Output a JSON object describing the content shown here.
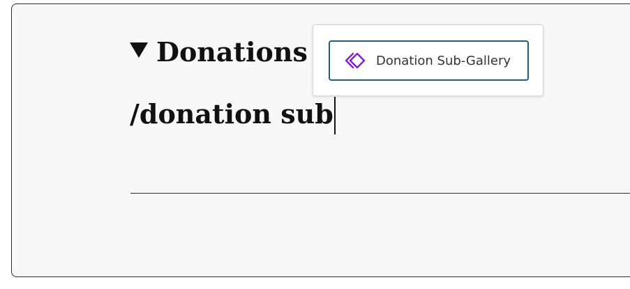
{
  "editor": {
    "heading": "Donations",
    "command_text": "/donation sub"
  },
  "autocomplete": {
    "items": [
      {
        "label": "Donation Sub-Gallery",
        "icon": "gallery-block-icon",
        "icon_color": "#7b1fd6"
      }
    ],
    "accent_color": "#1f5f78"
  }
}
